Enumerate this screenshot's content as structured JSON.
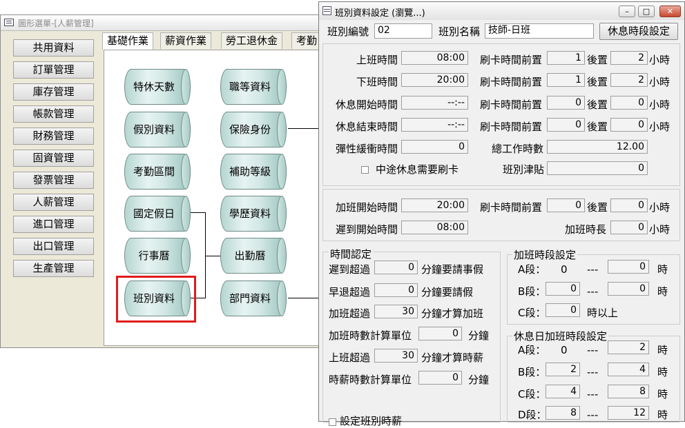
{
  "bg_window": {
    "title": "圖形選單-[人薪管理]",
    "menu": [
      "共用資料",
      "訂單管理",
      "庫存管理",
      "帳款管理",
      "財務管理",
      "固資管理",
      "發票管理",
      "人薪管理",
      "進口管理",
      "出口管理",
      "生產管理"
    ],
    "tabs": [
      "基礎作業",
      "薪資作業",
      "勞工退休金",
      "考勤"
    ],
    "nodes": {
      "special_leave": "特休天數",
      "leave_types": "假別資料",
      "attendance_period": "考勤區間",
      "national_holiday": "國定假日",
      "calendar": "行事曆",
      "shift_data": "班別資料",
      "job_grade": "職等資料",
      "insurance": "保險身份",
      "subsidy_grade": "補助等級",
      "education": "學歷資料",
      "attendance_cal": "出勤曆",
      "department": "部門資料"
    }
  },
  "dialog": {
    "title": "班別資料設定 (瀏覽...)",
    "shift_no_label": "班別編號",
    "shift_no": "02",
    "shift_name_label": "班別名稱",
    "shift_name": "技師-日班",
    "rest_button": "休息時段設定",
    "rows": {
      "work_start": {
        "label": "上班時間",
        "value": "08:00"
      },
      "work_end": {
        "label": "下班時間",
        "value": "20:00"
      },
      "rest_start": {
        "label": "休息開始時間",
        "value": "--:--"
      },
      "rest_end": {
        "label": "休息結束時間",
        "value": "--:--"
      },
      "flex": {
        "label": "彈性緩衝時間",
        "value": "0"
      }
    },
    "swipe_before_label": "刷卡時間前置",
    "after_label": "後置",
    "hour_unit": "小時",
    "swipe": [
      {
        "before": "1",
        "after": "2"
      },
      {
        "before": "1",
        "after": "2"
      },
      {
        "before": "0",
        "after": "0"
      },
      {
        "before": "0",
        "after": "0"
      }
    ],
    "total_hours_label": "總工作時數",
    "total_hours": "12.00",
    "mid_rest_label": "中途休息需要刷卡",
    "allowance_label": "班別津貼",
    "allowance": "0",
    "ot": {
      "start_label": "加班開始時間",
      "start": "20:00",
      "late_label": "遲到開始時間",
      "late": "08:00",
      "before": "0",
      "after": "0",
      "duration_label": "加班時長",
      "duration": "0"
    },
    "time_rules": {
      "title": "時間認定",
      "late": {
        "label": "遲到超過",
        "value": "0",
        "suffix": "分鐘要請事假"
      },
      "early": {
        "label": "早退超過",
        "value": "0",
        "suffix": "分鐘要請假"
      },
      "overtime": {
        "label": "加班超過",
        "value": "30",
        "suffix": "分鐘才算加班"
      },
      "ot_unit": {
        "label": "加班時數計算單位",
        "value": "0",
        "suffix": "分鐘"
      },
      "work_over": {
        "label": "上班超過",
        "value": "30",
        "suffix": "分鐘才算時薪"
      },
      "hourly_unit": {
        "label": "時薪時數計算單位",
        "value": "0",
        "suffix": "分鐘"
      }
    },
    "ot_segments": {
      "title": "加班時段設定",
      "a_label": "A段：",
      "a_from": "0",
      "a_to": "0",
      "b_label": "B段：",
      "b_from": "0",
      "b_to": "0",
      "c_label": "C段：",
      "c_from": "0",
      "c_suffix": "時以上",
      "dash": "---",
      "hour": "時"
    },
    "holiday_ot": {
      "title": "休息日加班時段設定",
      "a_label": "A段：",
      "a_from": "0",
      "a_to": "2",
      "b_label": "B段：",
      "b_from": "2",
      "b_to": "4",
      "c_label": "C段：",
      "c_from": "4",
      "c_to": "8",
      "d_label": "D段：",
      "d_from": "8",
      "d_to": "12"
    },
    "bottom_cut": "設定班別時薪"
  }
}
